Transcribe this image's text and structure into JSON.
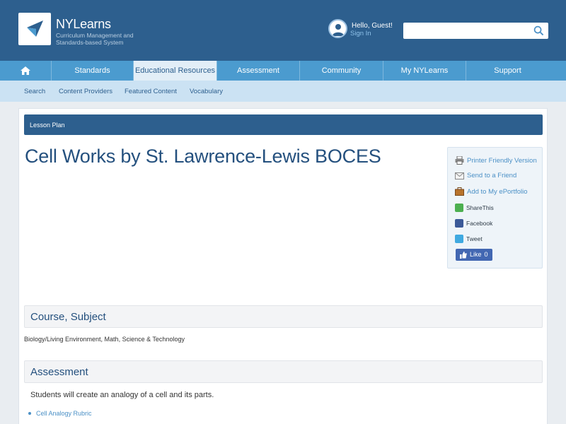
{
  "header": {
    "logo_title": "NYLearns",
    "logo_subtitle": "Curriculum Management and Standards-based System",
    "greeting": "Hello, Guest!",
    "signin_label": "Sign In",
    "search": {
      "value": "",
      "placeholder": ""
    }
  },
  "main_nav": {
    "home_icon": "home-icon",
    "items": [
      {
        "label": "Standards"
      },
      {
        "label": "Educational Resources",
        "active": true
      },
      {
        "label": "Assessment"
      },
      {
        "label": "Community"
      },
      {
        "label": "My NYLearns"
      },
      {
        "label": "Support"
      }
    ]
  },
  "sub_nav": {
    "items": [
      {
        "label": "Search"
      },
      {
        "label": "Content Providers"
      },
      {
        "label": "Featured Content"
      },
      {
        "label": "Vocabulary"
      }
    ]
  },
  "content": {
    "type_bar": "Lesson Plan",
    "title": "Cell Works by St. Lawrence-Lewis BOCES",
    "share": {
      "printer": "Printer Friendly Version",
      "send": "Send to a Friend",
      "portfolio": "Add to My ePortfolio",
      "sharethis": "ShareThis",
      "facebook": "Facebook",
      "tweet": "Tweet",
      "like_label": "Like",
      "like_count": "0"
    },
    "course_heading": "Course, Subject",
    "course_value": "Biology/Living Environment, Math, Science & Technology",
    "assessment_heading": "Assessment",
    "assessment_text": "Students will create an analogy of a cell and its parts.",
    "rubric_link": "Cell Analogy Rubric"
  },
  "colors": {
    "header_bg": "#2d5f8e",
    "nav_bg": "#4b9bcf",
    "subnav_bg": "#cbe2f3",
    "link": "#4b90c6",
    "title": "#24507e"
  }
}
